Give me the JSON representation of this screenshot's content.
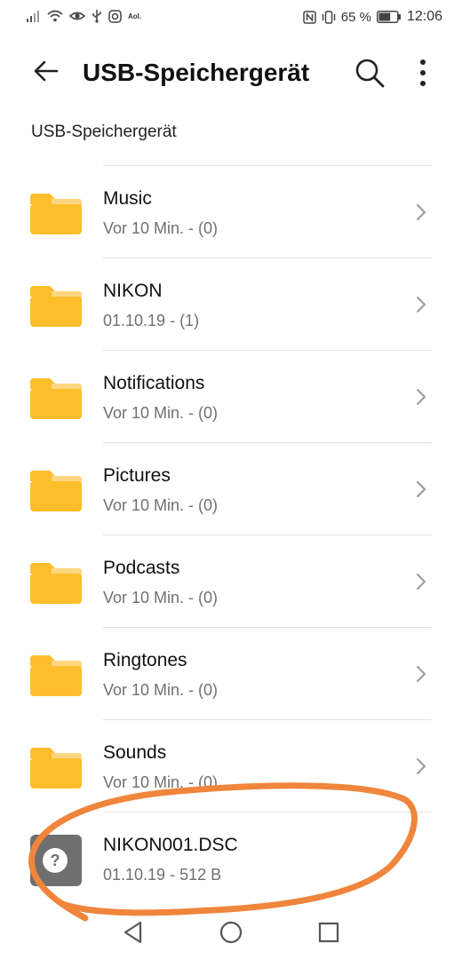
{
  "status_bar": {
    "left_icons": [
      "signal-icon",
      "wifi-icon",
      "eye-icon",
      "usb-icon",
      "instagram-icon"
    ],
    "aol_label": "Aol.",
    "right_icons": [
      "nfc-icon",
      "vibrate-icon"
    ],
    "battery_percent": "65 %",
    "battery_level": 0.65,
    "time": "12:06"
  },
  "app_bar": {
    "title": "USB-Speichergerät",
    "icons": [
      "back-arrow-icon",
      "search-icon",
      "more-vert-icon"
    ]
  },
  "breadcrumb": "USB-Speichergerät",
  "colors": {
    "folder": "#FDBE2C",
    "folder_tab": "#FCD680",
    "file_icon_bg": "#6F6F6F",
    "annotation_stroke": "#F0853C"
  },
  "items": [
    {
      "name": "Music",
      "meta": "Vor 10 Min. - (0)",
      "type": "folder"
    },
    {
      "name": "NIKON",
      "meta": "01.10.19 - (1)",
      "type": "folder"
    },
    {
      "name": "Notifications",
      "meta": "Vor 10 Min. - (0)",
      "type": "folder"
    },
    {
      "name": "Pictures",
      "meta": "Vor 10 Min. - (0)",
      "type": "folder"
    },
    {
      "name": "Podcasts",
      "meta": "Vor 10 Min. - (0)",
      "type": "folder"
    },
    {
      "name": "Ringtones",
      "meta": "Vor 10 Min. - (0)",
      "type": "folder"
    },
    {
      "name": "Sounds",
      "meta": "Vor 10 Min. - (0)",
      "type": "folder"
    },
    {
      "name": "NIKON001.DSC",
      "meta": "01.10.19 - 512 B",
      "type": "unknown-file",
      "icon_glyph": "?"
    }
  ],
  "nav_bar": {
    "icons": [
      "back-triangle-icon",
      "home-circle-icon",
      "recents-square-icon"
    ]
  }
}
